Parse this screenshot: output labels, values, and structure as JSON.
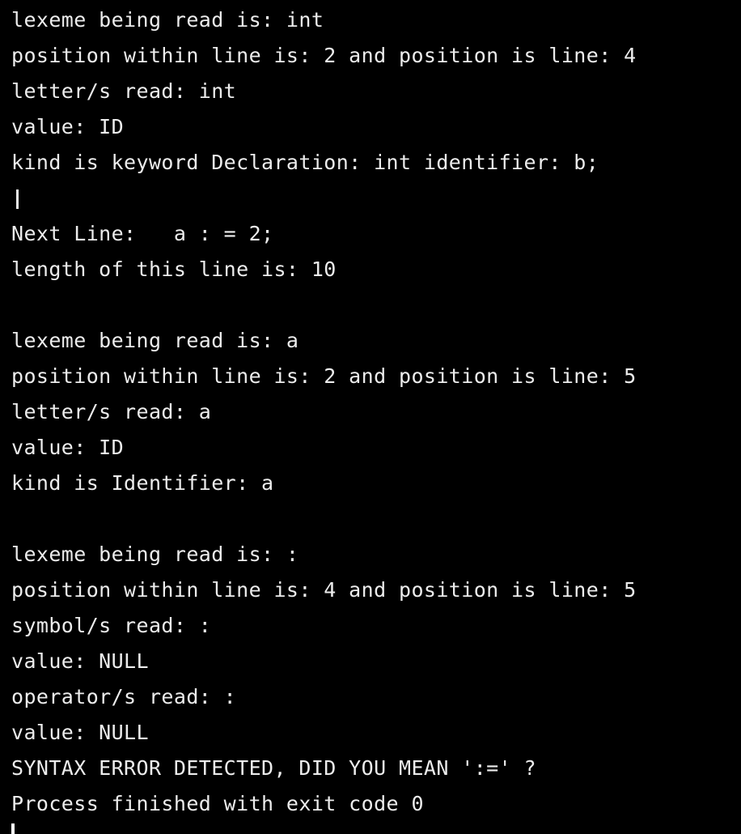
{
  "console": {
    "lines": [
      "lexeme being read is: int",
      "position within line is: 2 and position is line: 4",
      "letter/s read: int",
      "value: ID",
      "kind is keyword Declaration: int identifier: b;",
      "",
      "Next Line:   a : = 2;",
      "length of this line is: 10",
      "",
      "lexeme being read is: a",
      "position within line is: 2 and position is line: 5",
      "letter/s read: a",
      "value: ID",
      "kind is Identifier: a",
      "",
      "lexeme being read is: :",
      "position within line is: 4 and position is line: 5",
      "symbol/s read: :",
      "value: NULL",
      "operator/s read: :",
      "value: NULL",
      "SYNTAX ERROR DETECTED, DID YOU MEAN ':=' ?",
      "Process finished with exit code 0"
    ]
  }
}
